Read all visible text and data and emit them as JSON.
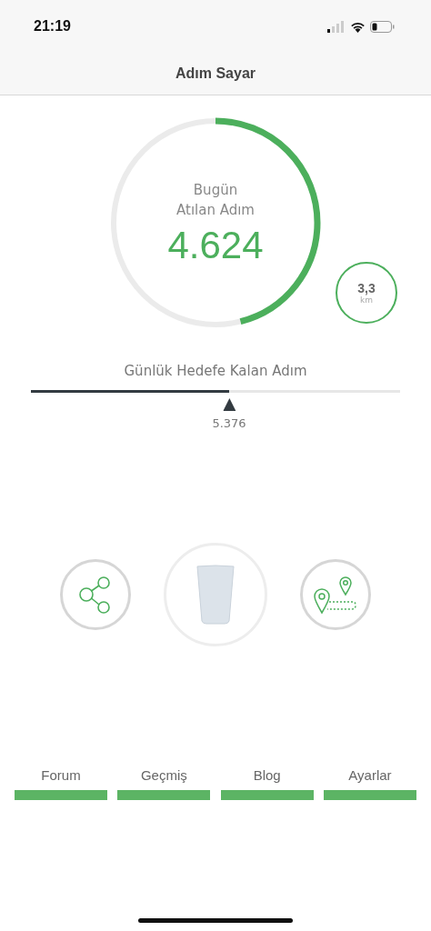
{
  "status_bar": {
    "time": "21:19"
  },
  "nav": {
    "title": "Adım Sayar"
  },
  "progress": {
    "line1": "Bugün",
    "line2": "Atılan Adım",
    "steps": "4.624"
  },
  "distance": {
    "value": "3,3",
    "unit": "km"
  },
  "goal": {
    "label": "Günlük Hedefe Kalan Adım",
    "level": 0.537,
    "value": "5.376"
  },
  "tabs": [
    {
      "label": "Forum"
    },
    {
      "label": "Geçmiş"
    },
    {
      "label": "Blog"
    },
    {
      "label": "Ayarlar"
    }
  ]
}
